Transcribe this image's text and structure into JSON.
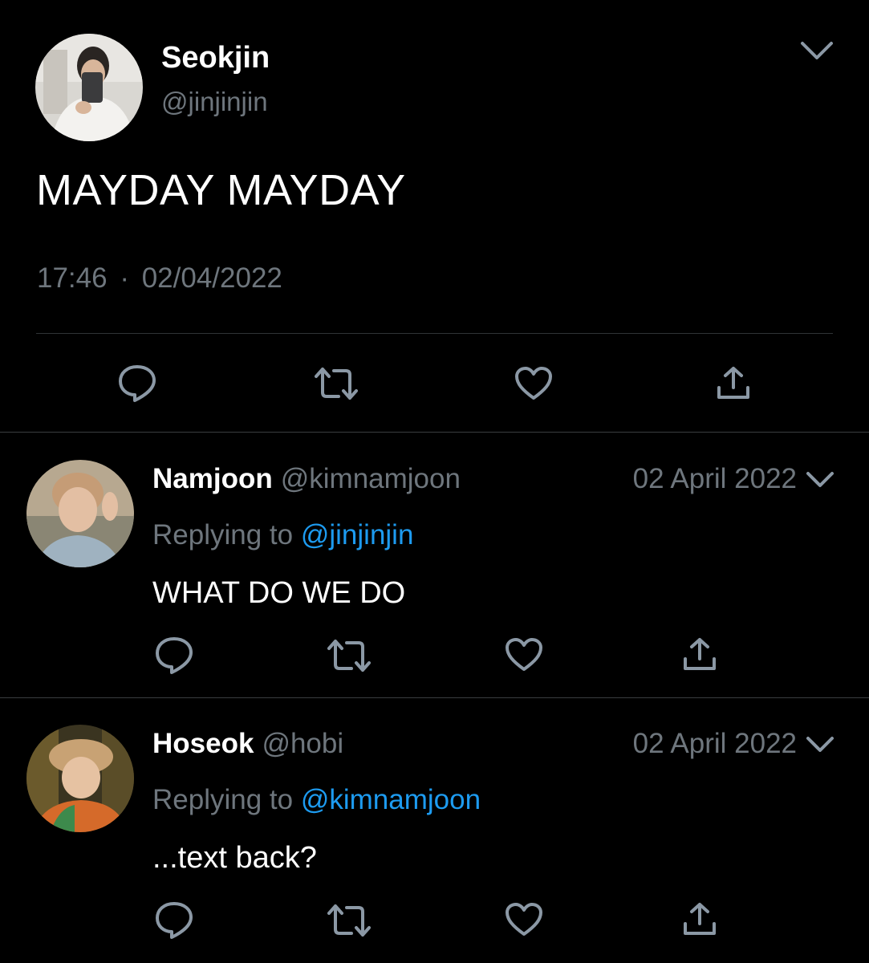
{
  "main_tweet": {
    "author_name": "Seokjin",
    "author_handle": "@jinjinjin",
    "text": "MAYDAY MAYDAY",
    "time": "17:46",
    "separator": "·",
    "date": "02/04/2022",
    "icons": [
      "reply-icon",
      "retweet-icon",
      "like-icon",
      "share-icon",
      "chevron-down-icon"
    ]
  },
  "replies": [
    {
      "author_name": "Namjoon",
      "author_handle": "@kimnamjoon",
      "date": "02 April 2022",
      "replying_prefix": "Replying to",
      "replying_to": "@jinjinjin",
      "text": "WHAT DO WE DO"
    },
    {
      "author_name": "Hoseok",
      "author_handle": "@hobi",
      "date": "02 April 2022",
      "replying_prefix": "Replying to",
      "replying_to": "@kimnamjoon",
      "text": "...text back?"
    }
  ],
  "colors": {
    "background": "#000000",
    "primary_text": "#ffffff",
    "secondary_text": "#6e767d",
    "link": "#1d9bf0",
    "icon": "#8b98a5",
    "divider": "#2f3336"
  }
}
